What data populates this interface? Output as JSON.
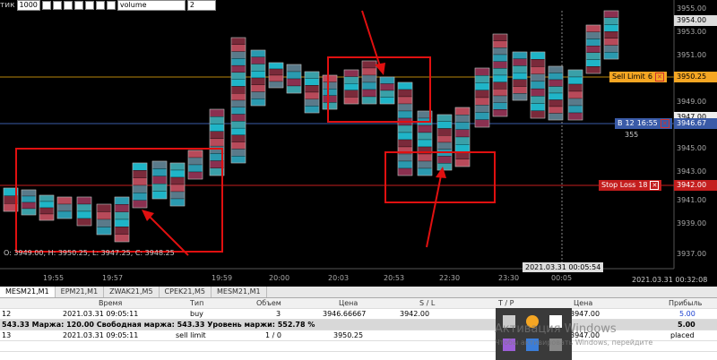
{
  "toolbar": {
    "label": "тик",
    "tick_value": "1000",
    "mode": "volume",
    "count": "2"
  },
  "price_axis": [
    "3955.00",
    "3953.00",
    "3951.00",
    "3949.00",
    "3947.00",
    "3945.00",
    "3943.00",
    "3941.00",
    "3939.00",
    "3937.00"
  ],
  "orders": {
    "sell_limit_label": "Sell Limit",
    "sell_limit_qty": "6",
    "sell_limit_price": "3950.25",
    "buy_label": "B",
    "buy_qty": "12",
    "buy_timer": "16:55",
    "buy_price": "3946.67",
    "buy_sub": "355",
    "stop_loss_label": "Stop Loss",
    "stop_loss_qty": "18",
    "stop_loss_price": "3942.00",
    "last_price": "3954.00",
    "price_3947": "3947.00"
  },
  "ohlc": "O: 3949.00, H: 3950.25, L: 3947.25, C: 3948.25",
  "time_axis": [
    "19:55",
    "19:57",
    "19:59",
    "20:00",
    "20:03",
    "20:53",
    "22:30",
    "23:30",
    "00:05"
  ],
  "cursor_time": "2021.03.31 00:05:54",
  "clock": "2021.03.31 00:32:08",
  "tabs": [
    "MESM21,M1",
    "EPM21,M1",
    "ZWAK21,M5",
    "CPEK21,M5",
    "MESM21,M1"
  ],
  "table": {
    "headers": [
      "Время",
      "Тип",
      "Объем",
      "Цена",
      "S / L",
      "T / P",
      "Цена",
      "Прибыль"
    ],
    "row1": {
      "id": "12",
      "time": "2021.03.31 09:05:11",
      "type": "buy",
      "vol": "3",
      "price": "3946.66667",
      "sl": "3942.00",
      "price2": "3947.00",
      "profit": "5.00"
    },
    "summary": "543.33  Маржа: 120.00  Свободная маржа: 543.33  Уровень маржи: 552.78 %",
    "summary_profit": "5.00",
    "row2": {
      "id": "13",
      "time": "2021.03.31 09:05:11",
      "type": "sell limit",
      "vol": "1 / 0",
      "price": "3950.25",
      "price2": "3947.00",
      "status": "placed"
    }
  },
  "watermark": "Активация Windows",
  "watermark_sub": "Чтобы активировать Windows, перейдите",
  "colors": {
    "bg": "#000000",
    "sell_limit": "#f5a623",
    "buy": "#3a5ba8",
    "stop": "#c41e1e",
    "annot": "#e01010"
  }
}
